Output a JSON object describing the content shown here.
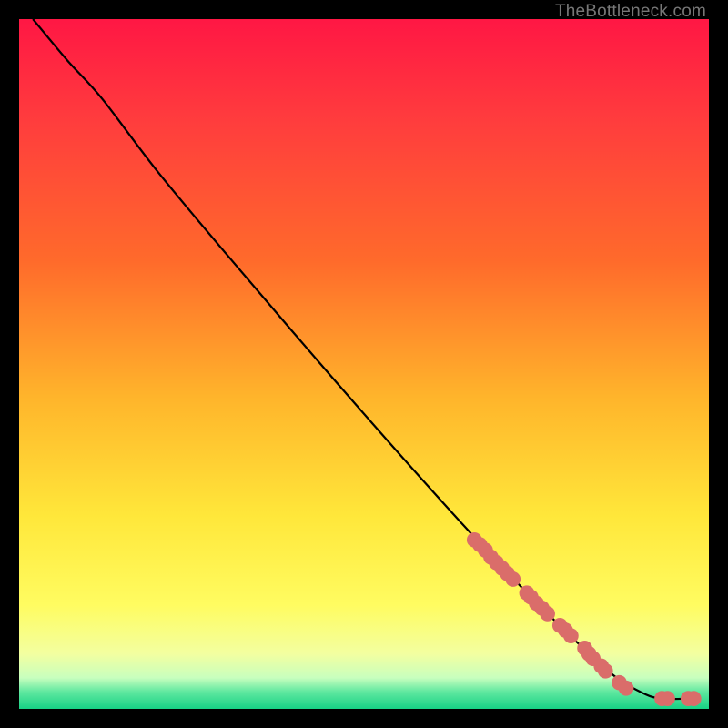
{
  "watermark": "TheBottleneck.com",
  "chart_data": {
    "type": "line",
    "title": "",
    "xlabel": "",
    "ylabel": "",
    "xlim": [
      0,
      100
    ],
    "ylim": [
      0,
      100
    ],
    "gradient_stops": [
      {
        "offset": 0.0,
        "color": "#ff1744"
      },
      {
        "offset": 0.15,
        "color": "#ff3d3d"
      },
      {
        "offset": 0.35,
        "color": "#ff6a2b"
      },
      {
        "offset": 0.55,
        "color": "#ffb52b"
      },
      {
        "offset": 0.72,
        "color": "#ffe73a"
      },
      {
        "offset": 0.85,
        "color": "#fffc61"
      },
      {
        "offset": 0.92,
        "color": "#f3ffa0"
      },
      {
        "offset": 0.955,
        "color": "#c8ffbe"
      },
      {
        "offset": 0.975,
        "color": "#60e8a0"
      },
      {
        "offset": 1.0,
        "color": "#17d185"
      }
    ],
    "curve": [
      {
        "x": 2.0,
        "y": 100.0
      },
      {
        "x": 7.0,
        "y": 94.0
      },
      {
        "x": 12.0,
        "y": 88.5
      },
      {
        "x": 20.0,
        "y": 78.0
      },
      {
        "x": 30.0,
        "y": 66.0
      },
      {
        "x": 45.0,
        "y": 48.5
      },
      {
        "x": 60.0,
        "y": 31.5
      },
      {
        "x": 72.0,
        "y": 18.5
      },
      {
        "x": 80.0,
        "y": 10.5
      },
      {
        "x": 86.0,
        "y": 5.0
      },
      {
        "x": 90.0,
        "y": 2.5
      },
      {
        "x": 93.0,
        "y": 1.5
      },
      {
        "x": 97.5,
        "y": 1.5
      }
    ],
    "dots": [
      {
        "x": 66.0,
        "y": 24.5
      },
      {
        "x": 66.8,
        "y": 23.8
      },
      {
        "x": 67.6,
        "y": 23.0
      },
      {
        "x": 68.4,
        "y": 22.0
      },
      {
        "x": 69.2,
        "y": 21.2
      },
      {
        "x": 70.0,
        "y": 20.4
      },
      {
        "x": 70.8,
        "y": 19.6
      },
      {
        "x": 71.6,
        "y": 18.8
      },
      {
        "x": 73.6,
        "y": 16.8
      },
      {
        "x": 74.2,
        "y": 16.2
      },
      {
        "x": 75.0,
        "y": 15.3
      },
      {
        "x": 75.8,
        "y": 14.6
      },
      {
        "x": 76.6,
        "y": 13.8
      },
      {
        "x": 78.4,
        "y": 12.1
      },
      {
        "x": 79.2,
        "y": 11.4
      },
      {
        "x": 80.0,
        "y": 10.6
      },
      {
        "x": 82.0,
        "y": 8.8
      },
      {
        "x": 82.6,
        "y": 8.0
      },
      {
        "x": 83.2,
        "y": 7.3
      },
      {
        "x": 84.4,
        "y": 6.2
      },
      {
        "x": 85.0,
        "y": 5.5
      },
      {
        "x": 87.0,
        "y": 3.8
      },
      {
        "x": 88.0,
        "y": 3.0
      },
      {
        "x": 93.2,
        "y": 1.5
      },
      {
        "x": 94.0,
        "y": 1.5
      },
      {
        "x": 97.0,
        "y": 1.5
      },
      {
        "x": 97.8,
        "y": 1.5
      }
    ],
    "dot_color": "#da6d6a",
    "dot_radius": 1.1,
    "line_color": "#000000"
  }
}
